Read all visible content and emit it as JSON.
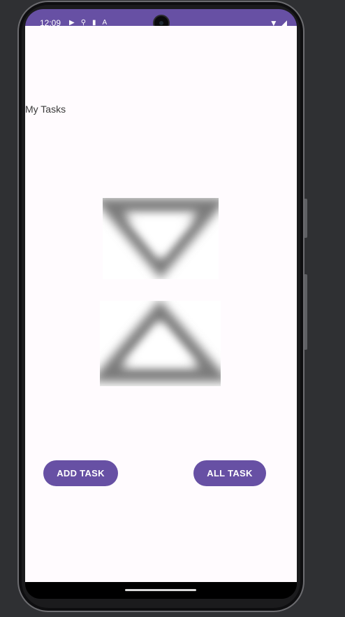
{
  "status_bar": {
    "time": "12:09",
    "icons": [
      "play-store-icon",
      "usb-icon",
      "sd-card-icon",
      "accessibility-icon"
    ],
    "right_icons": [
      "wifi-icon",
      "signal-icon"
    ],
    "color": "#6750a4"
  },
  "app": {
    "title": "My Tasks",
    "background": "#fffbfe",
    "images": [
      "chevron-down-image",
      "chevron-up-image"
    ]
  },
  "buttons": {
    "add_task": "ADD TASK",
    "all_task": "ALL TASK",
    "color": "#6750a4"
  }
}
